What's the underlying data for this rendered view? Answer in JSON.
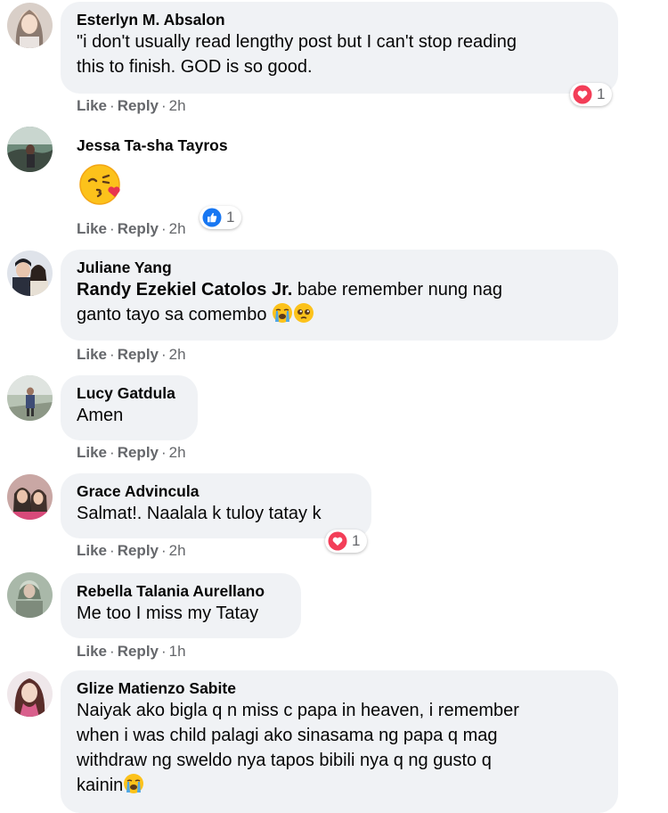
{
  "comments": [
    {
      "author": "Esterlyn M. Absalon",
      "text_line1": "\"i don't usually read lengthy post but I can't stop reading",
      "text_line2": "this to finish. GOD is so good.",
      "actions": {
        "like": "Like",
        "reply": "Reply",
        "time": "2h"
      },
      "reaction": {
        "type": "heart",
        "count": "1"
      }
    },
    {
      "author": "Jessa Ta-sha Tayros",
      "emoji": "kissing-face-heart",
      "actions": {
        "like": "Like",
        "reply": "Reply",
        "time": "2h"
      },
      "reaction": {
        "type": "like",
        "count": "1"
      }
    },
    {
      "author": "Juliane Yang",
      "mention": "Randy Ezekiel Catolos Jr.",
      "text_line1": " babe remember nung nag",
      "text_line2": "ganto tayo sa comembo ",
      "actions": {
        "like": "Like",
        "reply": "Reply",
        "time": "2h"
      }
    },
    {
      "author": "Lucy Gatdula",
      "text_line1": "Amen",
      "actions": {
        "like": "Like",
        "reply": "Reply",
        "time": "2h"
      }
    },
    {
      "author": "Grace Advincula",
      "text_line1": "Salmat!. Naalala k tuloy tatay k",
      "actions": {
        "like": "Like",
        "reply": "Reply",
        "time": "2h"
      },
      "reaction": {
        "type": "heart",
        "count": "1"
      }
    },
    {
      "author": "Rebella Talania Aurellano",
      "text_line1": "Me too I miss my Tatay",
      "actions": {
        "like": "Like",
        "reply": "Reply",
        "time": "1h"
      }
    },
    {
      "author": "Glize Matienzo Sabite",
      "text_line1": "Naiyak ako bigla q n miss c papa in heaven, i remember",
      "text_line2": "when i was child palagi ako sinasama ng papa q mag",
      "text_line3": "withdraw ng sweldo nya tapos bibili nya q ng gusto q",
      "text_line4": "kainin"
    }
  ],
  "separator": "·",
  "colors": {
    "bubble": "#f0f2f5",
    "action_text": "#65676b",
    "like_blue": "#1877f2",
    "heart_red": "#f33e58"
  }
}
